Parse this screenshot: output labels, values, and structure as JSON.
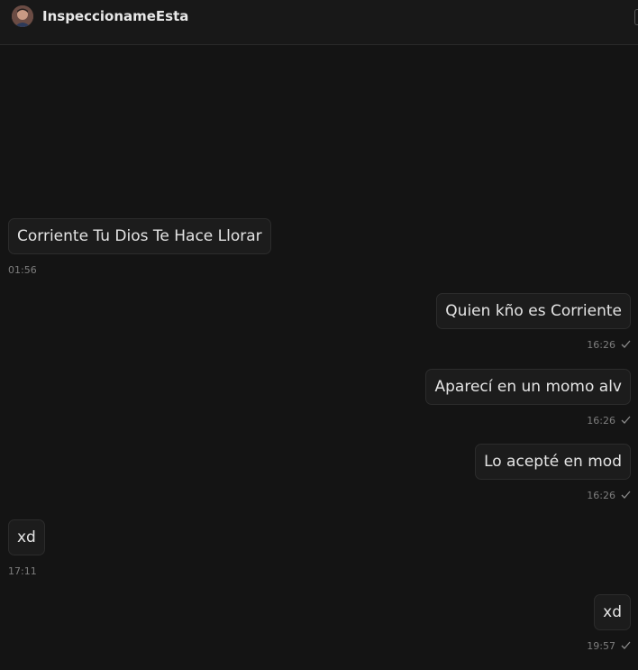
{
  "header": {
    "contact_name": "InspeccionameEsta"
  },
  "messages": [
    {
      "direction": "in",
      "text": "Corriente Tu Dios Te Hace Llorar",
      "time": "01:56"
    },
    {
      "direction": "out",
      "text": "Quien kño es Corriente",
      "time": "16:26",
      "status_icon": "check-icon"
    },
    {
      "direction": "out",
      "text": "Aparecí en un momo alv",
      "time": "16:26",
      "status_icon": "check-icon"
    },
    {
      "direction": "out",
      "text": "Lo acepté en mod",
      "time": "16:26",
      "status_icon": "check-icon"
    },
    {
      "direction": "in",
      "text": "xd",
      "time": "17:11"
    },
    {
      "direction": "out",
      "text": "xd",
      "time": "19:57",
      "status_icon": "check-icon"
    }
  ],
  "colors": {
    "background": "#141414",
    "bubble": "#1c1c1c",
    "text": "#e4e4e4",
    "timestamp": "#7d7d7d"
  }
}
